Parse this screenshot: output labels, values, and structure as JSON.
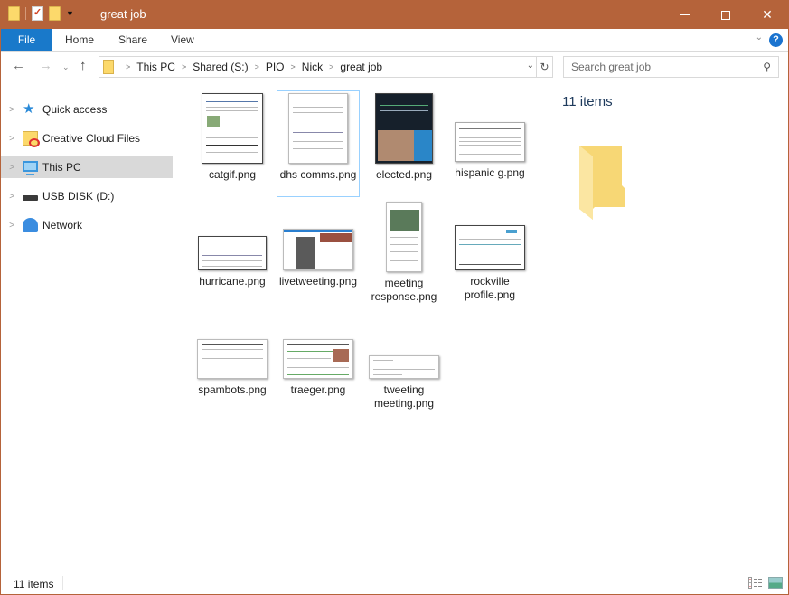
{
  "window": {
    "title": "great job",
    "controls": {
      "minimize": "minimize",
      "maximize": "maximize",
      "close": "✕"
    }
  },
  "quick_access_toolbar": {
    "icons": [
      "folder-icon",
      "properties-icon",
      "new-folder-icon",
      "customize-dropdown-icon"
    ]
  },
  "ribbon": {
    "tabs": [
      "File",
      "Home",
      "Share",
      "View"
    ],
    "expand_icon": "chevron-down-icon",
    "help_label": "?"
  },
  "navigation": {
    "back": "←",
    "forward": "→",
    "recent": "⌄",
    "up": "↑"
  },
  "address_bar": {
    "breadcrumbs": [
      "This PC",
      "Shared (S:)",
      "PIO",
      "Nick",
      "great job"
    ]
  },
  "search": {
    "placeholder": "Search great job",
    "icon": "⌕"
  },
  "sidebar": {
    "items": [
      {
        "label": "Quick access",
        "icon": "star-icon",
        "selected": false
      },
      {
        "label": "Creative Cloud Files",
        "icon": "creative-cloud-folder-icon",
        "selected": false
      },
      {
        "label": "This PC",
        "icon": "computer-icon",
        "selected": true
      },
      {
        "label": "USB DISK (D:)",
        "icon": "usb-drive-icon",
        "selected": false
      },
      {
        "label": "Network",
        "icon": "network-icon",
        "selected": false
      }
    ]
  },
  "files": [
    {
      "name": "catgif.png",
      "selected": false
    },
    {
      "name": "dhs comms.png",
      "selected": true
    },
    {
      "name": "elected.png",
      "selected": false
    },
    {
      "name": "hispanic g.png",
      "selected": false
    },
    {
      "name": "hurricane.png",
      "selected": false
    },
    {
      "name": "livetweeting.png",
      "selected": false
    },
    {
      "name": "meeting response.png",
      "selected": false
    },
    {
      "name": "rockville profile.png",
      "selected": false
    },
    {
      "name": "spambots.png",
      "selected": false
    },
    {
      "name": "traeger.png",
      "selected": false
    },
    {
      "name": "tweeting meeting.png",
      "selected": false
    }
  ],
  "preview_pane": {
    "item_count": "11 items"
  },
  "status_bar": {
    "item_count": "11 items",
    "view_buttons": [
      "details-view-icon",
      "large-icons-view-icon"
    ]
  },
  "colors": {
    "titlebar": "#b5633a",
    "file_tab": "#1979ca",
    "selection_border": "#99d1ff",
    "sidebar_selected": "#d9d9d9"
  }
}
